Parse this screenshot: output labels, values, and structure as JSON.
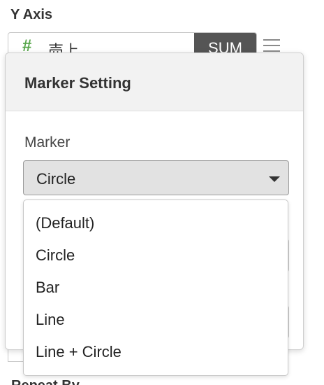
{
  "y_axis": {
    "title": "Y Axis",
    "field": {
      "type_icon": "#",
      "name": "売上",
      "aggregation": "SUM"
    },
    "menu_icon": "hamburger-icon"
  },
  "marker_setting": {
    "title": "Marker Setting",
    "marker": {
      "label": "Marker",
      "selected": "Circle",
      "options": [
        "(Default)",
        "Circle",
        "Bar",
        "Line",
        "Line + Circle"
      ]
    }
  },
  "below_popover": {
    "partial_heading": "Repeat By"
  }
}
